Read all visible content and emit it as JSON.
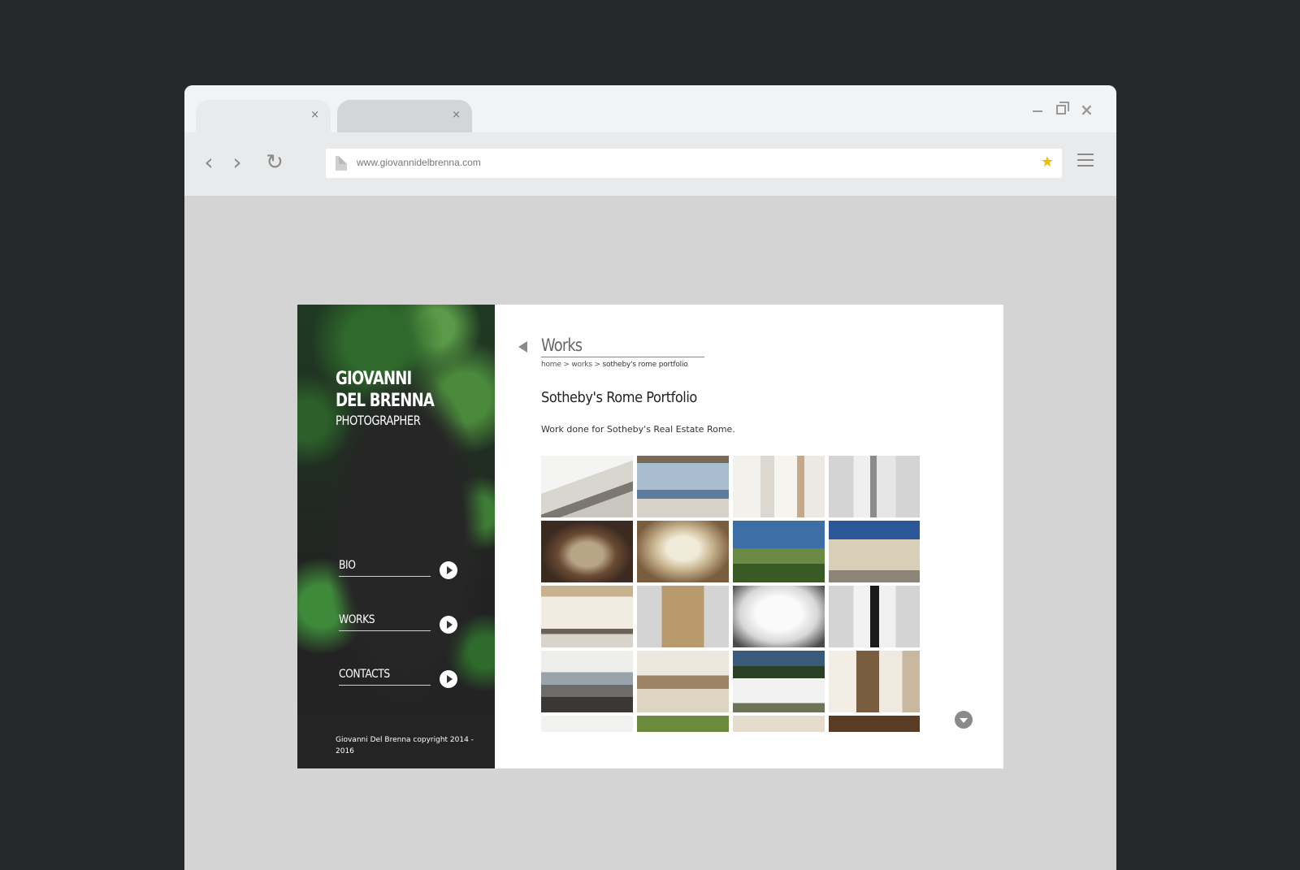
{
  "browser": {
    "tabs": [
      {
        "label": "",
        "close": "×"
      },
      {
        "label": "",
        "close": "×"
      }
    ],
    "window_close": "×",
    "url": "www.giovannidelbrenna.com",
    "star": "★"
  },
  "site": {
    "brand": {
      "line1": "GIOVANNI",
      "line2": "DEL BRENNA",
      "subtitle": "PHOTOGRAPHER"
    },
    "menu": [
      {
        "label": "BIO"
      },
      {
        "label": "WORKS"
      },
      {
        "label": "CONTACTS"
      }
    ],
    "copyright": "Giovanni Del Brenna copyright 2014 - 2016",
    "section_title": "Works",
    "breadcrumb": {
      "home": "home",
      "sep1": " > ",
      "works": "works",
      "sep2": " > ",
      "current": "sotheby's rome portfolio"
    },
    "portfolio_title": "Sotheby's Rome Portfolio",
    "portfolio_desc": "Work done for Sotheby's Real Estate Rome.",
    "gallery_count": 20
  },
  "colors": {
    "page_bg": "#27282a",
    "browser_chrome": "#e9eaeb",
    "viewport_bg": "#d4d4d4",
    "star": "#e6c000"
  }
}
